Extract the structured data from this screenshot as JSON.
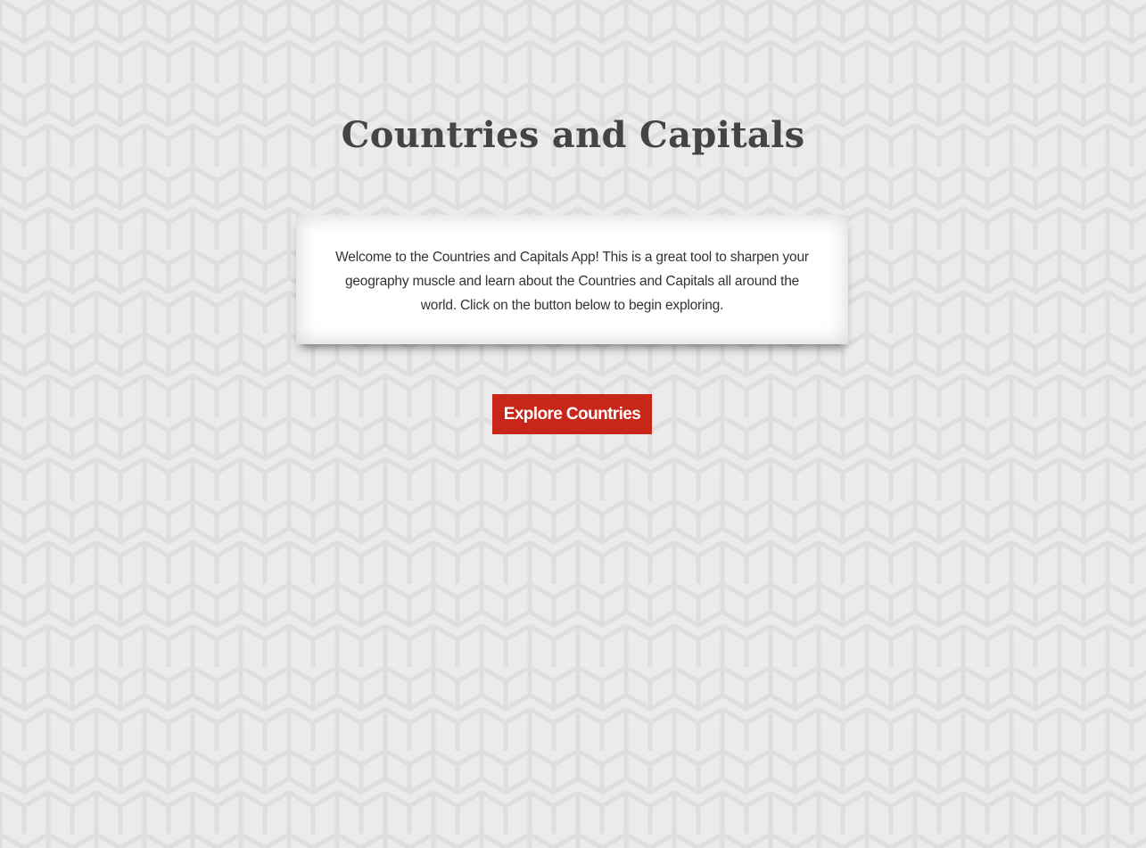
{
  "page": {
    "title": "Countries and Capitals",
    "background_color": "#ebebeb",
    "pattern": "isometric-cube-lines"
  },
  "welcome_card": {
    "text": "Welcome to the Countries and Capitals App! This is a great tool to sharpen your geography muscle and learn about the Countries and Capitals all around the world. Click on the button below to begin exploring."
  },
  "explore_button": {
    "label": "Explore Countries",
    "color": "#c9261a"
  }
}
